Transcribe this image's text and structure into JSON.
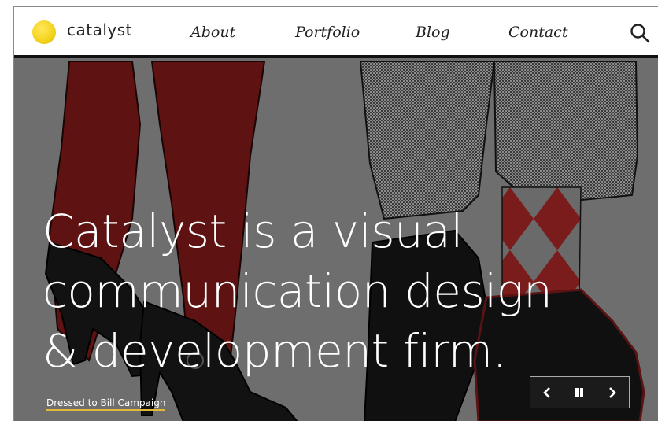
{
  "brand": {
    "name": "catalyst",
    "accent": "#f3d21c"
  },
  "nav": {
    "items": [
      {
        "label": "About"
      },
      {
        "label": "Portfolio"
      },
      {
        "label": "Blog"
      },
      {
        "label": "Contact"
      }
    ],
    "search_icon": "search-icon"
  },
  "hero": {
    "headline_lines": [
      "Catalyst is a visual",
      "communication design",
      "& development firm."
    ],
    "caption_link": "Dressed to Bill Campaign",
    "caption_underline_color": "#e0b93a",
    "controls": {
      "prev_icon": "chevron-left-icon",
      "pause_icon": "pause-icon",
      "next_icon": "chevron-right-icon"
    },
    "colors": {
      "background": "#6e6e6e",
      "stocking": "#5e1212",
      "shoe": "#121212",
      "sock_red": "#7a1c1c"
    }
  }
}
